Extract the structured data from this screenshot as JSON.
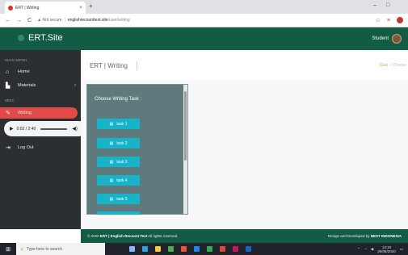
{
  "browser": {
    "tab_title": "ERT | Writing",
    "tab_close": "×",
    "new_tab": "+",
    "back": "←",
    "forward": "→",
    "reload": "C",
    "security": "▲ Not secure",
    "url_host": "englishrecounttext.site",
    "url_path": "/user/writing",
    "star": "☆",
    "minimize": "–",
    "maximize": "□"
  },
  "app": {
    "brand": "ERT.Site",
    "user_label": "Student"
  },
  "sidebar": {
    "main_menu": "MAIN MENU",
    "misc": "MISC",
    "items": [
      {
        "label": "Home",
        "icon": "home-icon"
      },
      {
        "label": "Materials",
        "icon": "book-icon"
      },
      {
        "label": "Writing",
        "icon": "pencil-icon"
      },
      {
        "label": "Log Out",
        "icon": "logout-icon"
      }
    ],
    "audio_time": "0:02 / 2:40"
  },
  "main": {
    "page_title": "ERT | Writing",
    "breadcrumb_link": "Quiz",
    "breadcrumb_current": "Choose",
    "task_heading": "Choose Writing Task :",
    "tasks": [
      "task 1",
      "task 2",
      "task 3",
      "task 4",
      "task 5"
    ]
  },
  "footer": {
    "left_prefix": "© 2020 ",
    "left_brand": "ERT | English Recount Text",
    "left_suffix": " All rights reserved.",
    "right_prefix": "Design and Developed by ",
    "right_brand": "NEST INDONESIA"
  },
  "taskbar": {
    "search_placeholder": "Type here to search",
    "time": "13:10",
    "date": "26/06/2020"
  },
  "colors": {
    "header_green": "#125b44",
    "sidebar_dark": "#2b2f33",
    "active_red": "#e24a4a",
    "task_button": "#17b3c9",
    "task_panel": "#5e7a7c"
  }
}
